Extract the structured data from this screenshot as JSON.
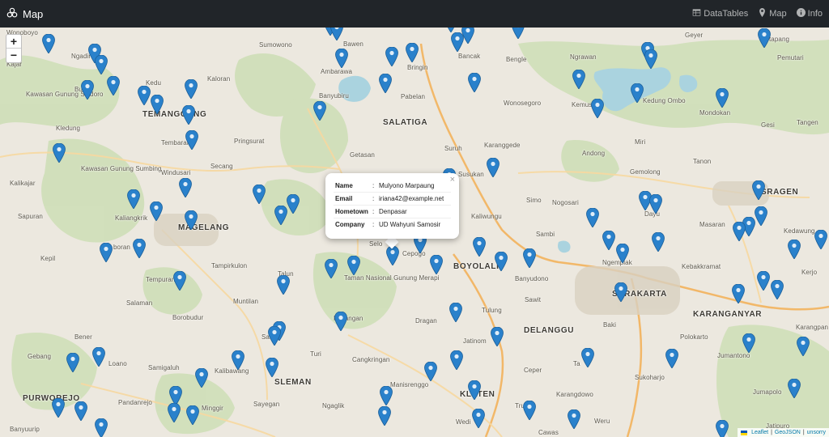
{
  "navbar": {
    "brand": "Map",
    "links": [
      {
        "label": "DataTables",
        "icon": "table-icon"
      },
      {
        "label": "Map",
        "icon": "map-marker-icon"
      },
      {
        "label": "Info",
        "icon": "info-circle-icon"
      }
    ]
  },
  "zoom": {
    "in": "+",
    "out": "−"
  },
  "popup": {
    "close": "×",
    "rows": [
      {
        "key": "Name",
        "sep": ":",
        "value": "Mulyono Marpaung"
      },
      {
        "key": "Email",
        "sep": ":",
        "value": "iriana42@example.net"
      },
      {
        "key": "Hometown",
        "sep": ":",
        "value": "Denpasar"
      },
      {
        "key": "Company",
        "sep": ":",
        "value": "UD Wahyuni Samosir"
      }
    ]
  },
  "attribution": {
    "leaflet": "Leaflet",
    "geojson": "GeoJSON",
    "unsorry": "unsorry",
    "sep": "|"
  },
  "places": {
    "wonoboyo": "Wonoboyo",
    "ngadirejo": "Ngadirejo",
    "kajar": "Kajar",
    "bulu": "Bulu",
    "kedu": "Kedu",
    "temanggung": "TEMANGGUNG",
    "kaloran": "Kaloran",
    "sumowono": "Sumowono",
    "bawen": "Bawen",
    "ambarawa": "Ambarawa",
    "bringin": "Bringin",
    "bancak": "Bancak",
    "bengle": "Bengle",
    "ngrawan": "Ngrawan",
    "geyer": "Geyer",
    "ketapang": "Ketapang",
    "pemutari": "Pemutari",
    "kawasan_sindoro": "Kawasan Gunung Sindoro",
    "banyubiru": "Banyubiru",
    "pabelan": "Pabelan",
    "wonosegoro": "Wonosegoro",
    "kemusu": "Kemusu",
    "kedung_ombo": "Kedung Ombo",
    "mondokan": "Mondokan",
    "gesi": "Gesi",
    "tangen": "Tangen",
    "kledung": "Kledung",
    "tembarak": "Tembarak",
    "pringsurat": "Pringsurat",
    "salatiga": "SALATIGA",
    "karanggede": "Karanggede",
    "miri": "Miri",
    "getasan": "Getasan",
    "suruh": "Suruh",
    "andong": "Andong",
    "tanon": "Tanon",
    "kawasan_sumbing": "Kawasan Gunung Sumbing",
    "windusari": "Windusari",
    "secang": "Secang",
    "gemolong": "Gemolong",
    "kalikajar": "Kalikajar",
    "simo": "Simo",
    "sragen": "SRAGEN",
    "sapuran": "Sapuran",
    "kaliangkrik": "Kaliangkrik",
    "magelang": "MAGELANG",
    "kaliwungu": "Kaliwungu",
    "masaran": "Masaran",
    "kedawung": "Kedawung",
    "sambi": "Sambi",
    "kepil": "Kepil",
    "boran": "boran",
    "selo": "Selo",
    "cepogo": "Cepogo",
    "boyolali": "BOYOLALI",
    "ngemplak": "Ngemplak",
    "kebakkramat": "Kebakkramat",
    "kerjo": "Kerjo",
    "tampirkulon": "Tampirkulon",
    "talun": "Talun",
    "taman_merapi": "Taman Nasional Gunung Merapi",
    "banyudono": "Banyudono",
    "tempuran": "Tempuran",
    "surakarta": "SURAKARTA",
    "sawit": "Sawit",
    "karanganyar": "KARANGANYAR",
    "salaman": "Salaman",
    "muntilan": "Muntilan",
    "borobudur": "Borobudur",
    "kaliangan": "Kaliangan",
    "dragan": "Dragan",
    "tulung": "Tulung",
    "delanggu": "DELANGGU",
    "baki": "Baki",
    "polokarto": "Polokarto",
    "karangpandan": "Karangpan",
    "bener": "Bener",
    "salam": "Salam",
    "jatinom": "Jatinom",
    "gebang": "Gebang",
    "loano": "Loano",
    "turi": "Turi",
    "cangkringan": "Cangkringan",
    "jumantono": "Jumantono",
    "samigaluh": "Samigaluh",
    "kalibawang": "Kalibawang",
    "sleman": "SLEMAN",
    "ceper": "Ceper",
    "ta": "Ta",
    "sukoharjo": "Sukoharjo",
    "jumapolo": "Jumapolo",
    "purworejo": "PURWOREJO",
    "pandanrejo": "Pandanrejo",
    "minggir": "Minggir",
    "sayegan": "Sayegan",
    "ngaglik": "Ngaglik",
    "manisrenggo": "Manisrenggo",
    "klaten": "KLATEN",
    "trucuk": "Trucuk",
    "karangdowo": "Karangdowo",
    "banyuurip": "Banyuurip",
    "wedi": "Wedi",
    "cawas": "Cawas",
    "weru": "Weru",
    "jatipuro": "Jatipuro",
    "nogosari": "Nogosari",
    "susukan": "Susukan",
    "dayu": "Dayu"
  }
}
